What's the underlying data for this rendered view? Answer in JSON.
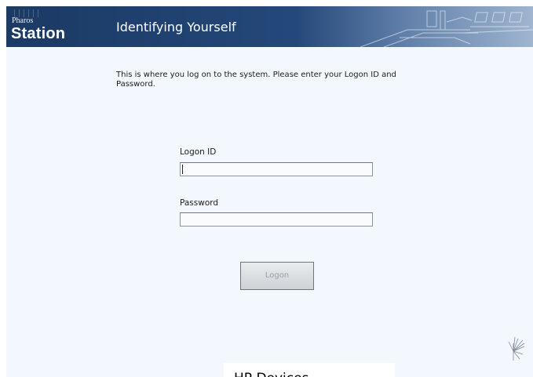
{
  "banner": {
    "logo_small": "Pharos",
    "logo_big": "Station",
    "title": "Identifying Yourself"
  },
  "intro_text": "This is where you log on to the system.  Please enter your Logon ID and Password.",
  "form": {
    "logon_id_label": "Logon ID",
    "logon_id_value": "",
    "password_label": "Password",
    "password_value": "",
    "logon_button_label": "Logon",
    "logon_button_enabled": false
  },
  "caption": "HP Devices",
  "icons": {
    "banner_art": "office-desks-illustration",
    "corner": "sparkle-logo-icon"
  },
  "colors": {
    "banner_dark": "#1b3a64",
    "page_background": "#f3f8fe"
  }
}
